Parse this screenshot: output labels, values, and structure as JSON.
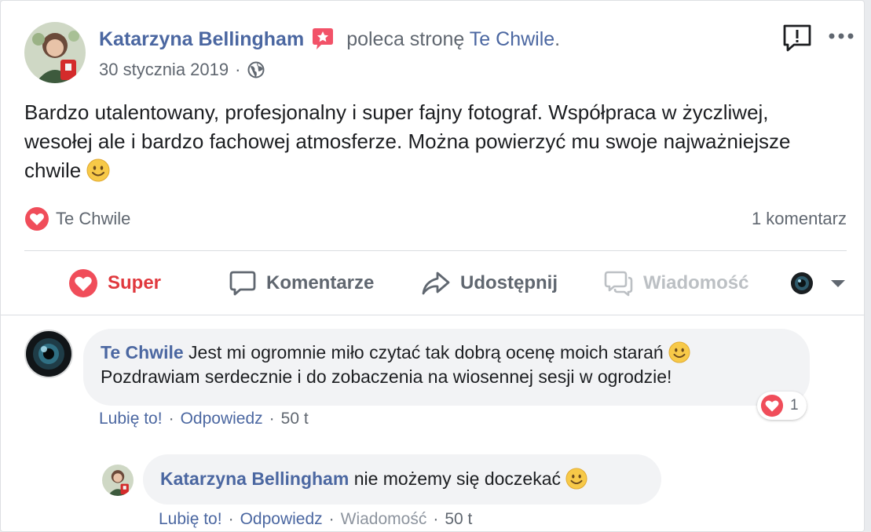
{
  "post": {
    "author": "Katarzyna Bellingham",
    "action_text": "poleca stronę",
    "page_name": "Te Chwile",
    "period": ".",
    "date": "30 stycznia 2019",
    "date_sep": "·",
    "body": "Bardzo utalentowany, profesjonalny i super fajny fotograf. Współpraca w życzliwej, wesołej ale i bardzo fachowej atmosferze. Można powierzyć mu swoje najważniejsze chwile",
    "reaction_name": "Te Chwile",
    "comment_count": "1 komentarz"
  },
  "actions": {
    "super": "Super",
    "comment": "Komentarze",
    "share": "Udostępnij",
    "message": "Wiadomość"
  },
  "comments": [
    {
      "author": "Te Chwile",
      "text_line1": "Jest mi ogromnie miło czytać tak dobrą ocenę moich starań",
      "text_line2": "Pozdrawiam serdecznie i do zobaczenia na wiosennej sesji w ogrodzie!",
      "like": "Lubię to!",
      "reply": "Odpowiedz",
      "time": "50 t",
      "reaction_count": "1",
      "sep": "·"
    },
    {
      "author": "Katarzyna Bellingham",
      "text": "nie możemy się doczekać",
      "like": "Lubię to!",
      "reply": "Odpowiedz",
      "message": "Wiadomość",
      "time": "50 t",
      "sep": "·"
    }
  ],
  "colors": {
    "link": "#4b67a1",
    "love": "#e0393e",
    "muted": "#606770"
  },
  "icons": [
    "recommendation-badge-icon",
    "globe-icon",
    "report-icon",
    "more-icon",
    "heart-icon",
    "comment-icon",
    "share-icon",
    "messenger-icon",
    "chevron-down-icon",
    "smile-emoji-icon"
  ]
}
